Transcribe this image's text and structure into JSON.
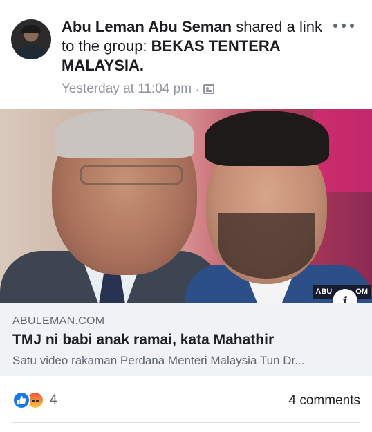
{
  "post": {
    "author": "Abu Leman Abu Seman",
    "action_text": " shared a link to the group: ",
    "group_name": "BEKAS TENTERA MALAYSIA",
    "group_suffix": ".",
    "timestamp": "Yesterday at 11:04 pm",
    "separator": "·",
    "audience_icon": "group-audience-icon",
    "more_icon": "more-horizontal-icon"
  },
  "link": {
    "watermark_left": "ABU",
    "watermark_right": "OM",
    "info_glyph": "i",
    "domain": "ABULEMAN.COM",
    "title": "TMJ ni babi anak ramai, kata Mahathir",
    "description": "Satu video rakaman Perdana Menteri Malaysia Tun Dr..."
  },
  "footer": {
    "reaction_count": "4",
    "comments": "4 comments",
    "reactions": [
      "like-icon",
      "angry-icon"
    ]
  },
  "colors": {
    "like_blue": "#1877f2",
    "meta_gray": "#90949c",
    "caption_bg": "#f0f2f5"
  }
}
